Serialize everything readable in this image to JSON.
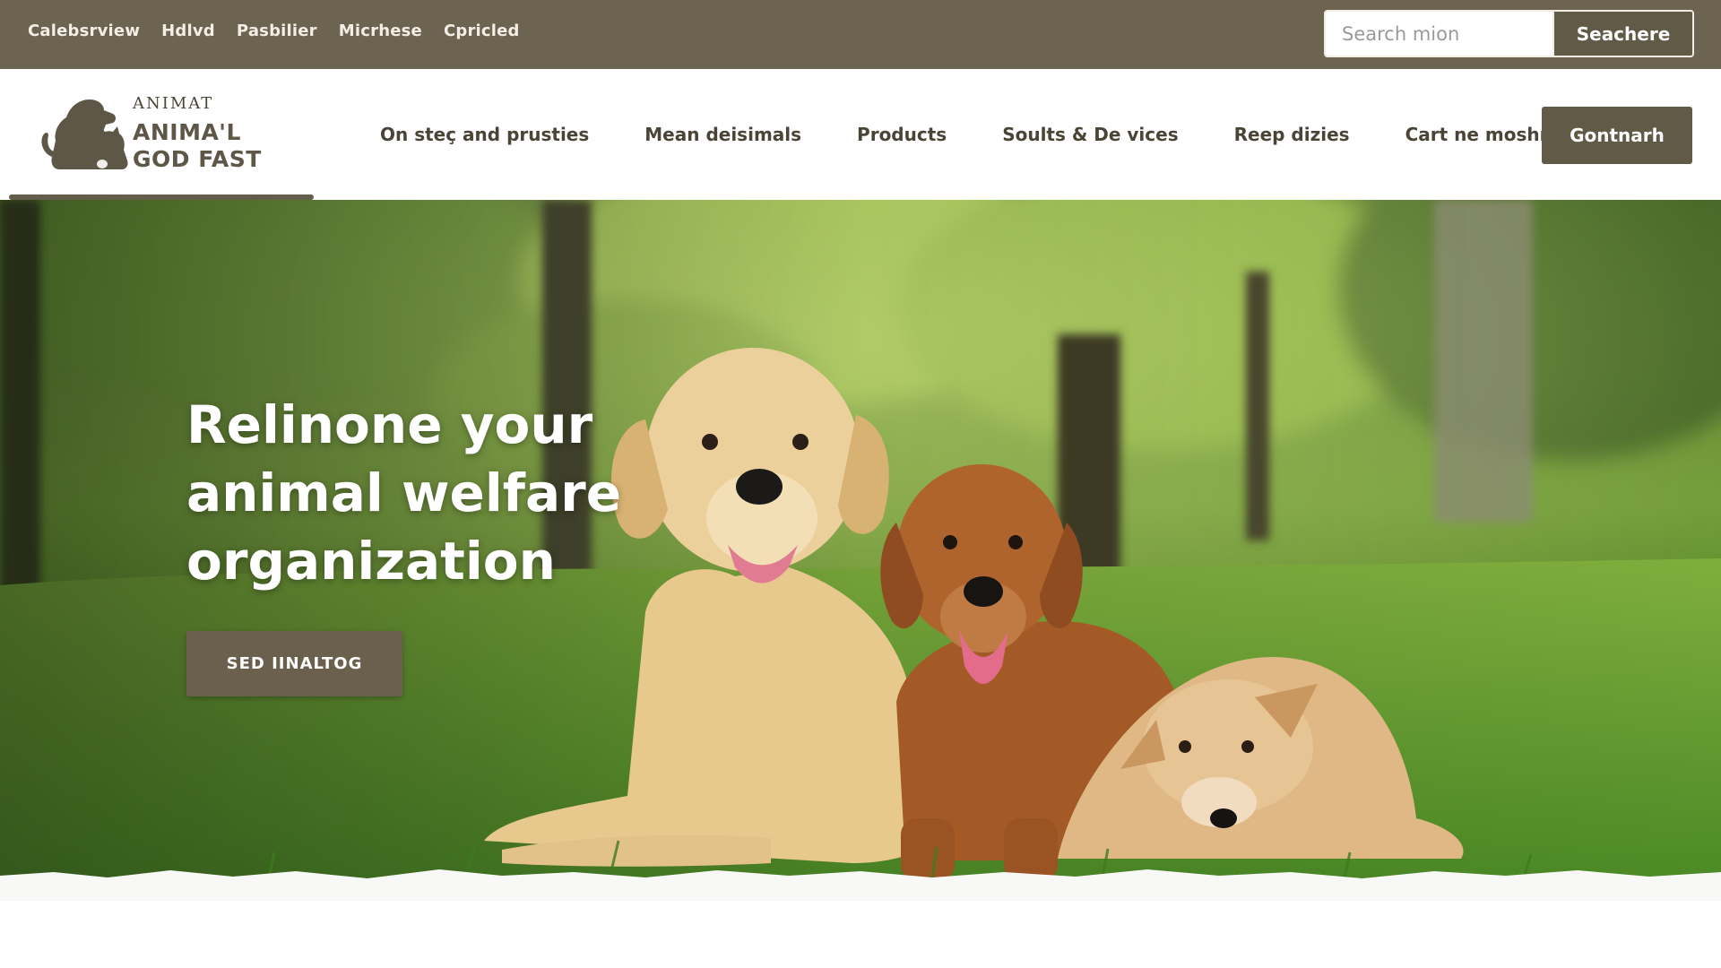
{
  "topbar": {
    "links": [
      "Calebsrview",
      "Hdlvd",
      "Pasbilier",
      "Micrhese",
      "Cpricled"
    ],
    "search": {
      "placeholder": "Search mion",
      "button_label": "Seachere"
    }
  },
  "header": {
    "logo": {
      "small": "ANIMAT",
      "line1": "ANIMA'L",
      "line2": "GOD FAST"
    },
    "nav": [
      "On steç and prusties",
      "Mean deisimals",
      "Products",
      "Soults & De vices",
      "Reep dizies",
      "Cart ne moshmre"
    ],
    "cta_label": "Gontnarh"
  },
  "hero": {
    "title": "Relinone your\nanimal welfare\norganization",
    "button_label": "SED IINALTOG"
  },
  "colors": {
    "topbar_bg": "#6c6451",
    "accent": "#615a47",
    "text_dark": "#4a4436",
    "grass": "#4f8a2c"
  },
  "icons": {
    "logo": "dog-and-cat-silhouette-icon"
  }
}
